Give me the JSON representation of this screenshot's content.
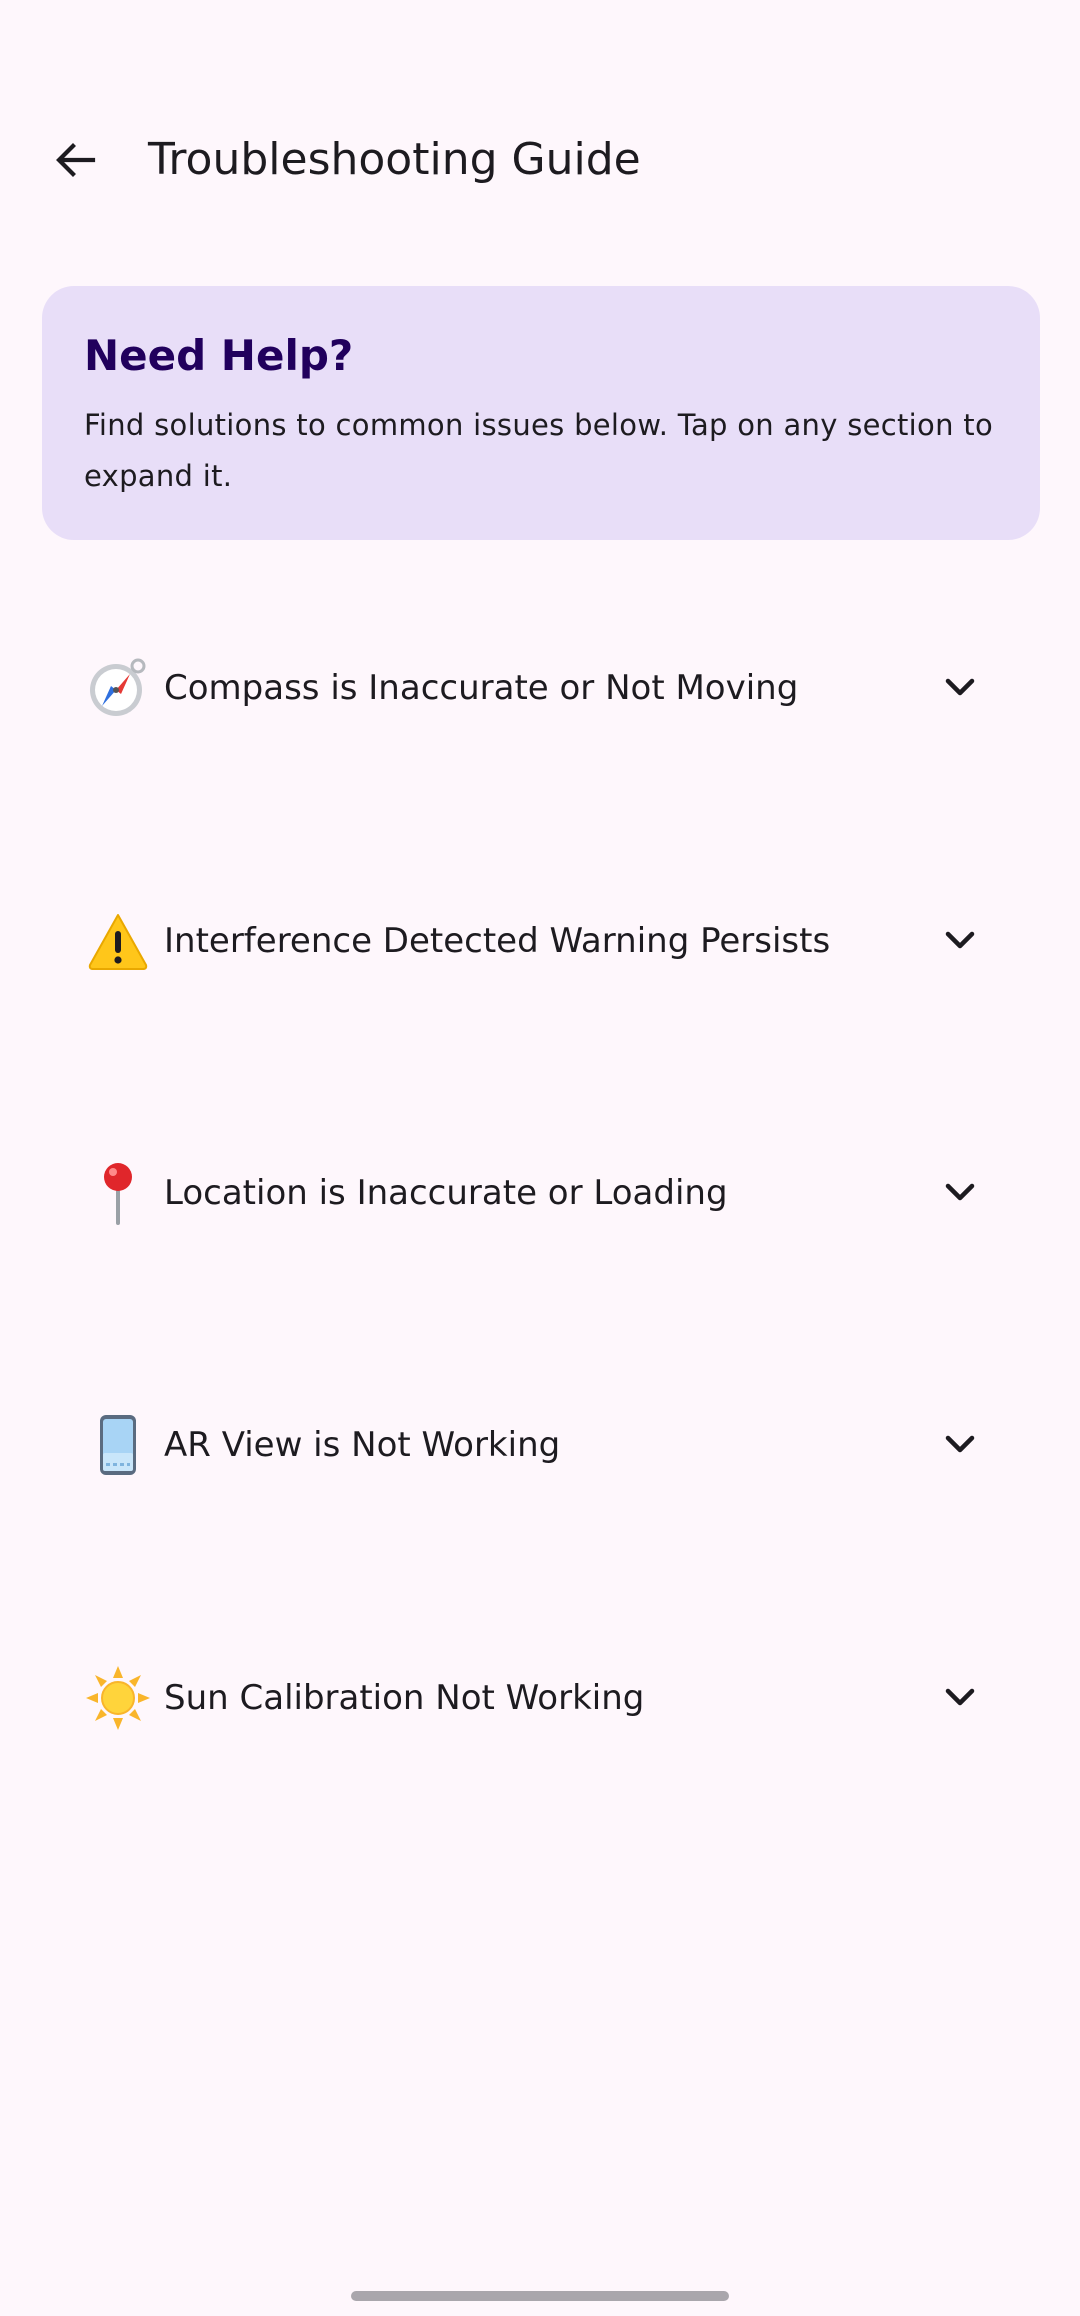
{
  "header": {
    "title": "Troubleshooting Guide"
  },
  "help_card": {
    "title": "Need Help?",
    "description": "Find solutions to common issues below. Tap on any section to expand it."
  },
  "sections": [
    {
      "label": "Compass is Inaccurate or Not Moving",
      "icon": "compass-icon"
    },
    {
      "label": "Interference Detected Warning Persists",
      "icon": "warning-icon"
    },
    {
      "label": "Location is Inaccurate or Loading",
      "icon": "pin-icon"
    },
    {
      "label": "AR View is Not Working",
      "icon": "phone-icon"
    },
    {
      "label": "Sun Calibration Not Working",
      "icon": "sun-icon"
    }
  ],
  "colors": {
    "background": "#FEF7FC",
    "card": "#E8DEF8",
    "card_title": "#21005D",
    "text": "#1D1B20"
  }
}
